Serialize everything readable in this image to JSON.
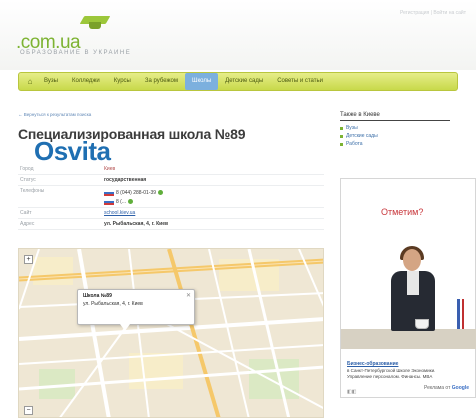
{
  "header": {
    "logo_main": "Osvita",
    "logo_domain": ".com.ua",
    "logo_tagline": "ОБРАЗОВАНИЕ В УКРАИНЕ",
    "top_links": "Регистрация  |  Войти на сайт"
  },
  "nav": {
    "home_icon": "home-icon",
    "items": [
      "Вузы",
      "Колледжи",
      "Курсы",
      "За рубежом",
      "Школы",
      "Детские сады",
      "Советы и статьи"
    ],
    "active_index": 4
  },
  "breadcrumb": "← Вернуться к результатам поиска",
  "page_title": "Специализированная школа №89",
  "details": {
    "city_label": "Город",
    "city_value": "Киев",
    "status_label": "Статус",
    "status_value": "государственная",
    "phones_label": "Телефоны",
    "phone1": "8 (044) 288-01-39",
    "phone2": "8 (...",
    "site_label": "Сайт",
    "site_value": "school.kiev.ua",
    "address_label": "Адрес",
    "address_value": "ул. Рыбальская, 4, г. Киев"
  },
  "map": {
    "balloon_title": "Школа №89",
    "balloon_address": "ул. Рыбальская, 4, г. Киев",
    "close_icon": "close-icon",
    "zoom_in": "+",
    "zoom_out": "−"
  },
  "sidebar": {
    "title": "Также в Киеве",
    "items": [
      "Вузы",
      "Детские сады",
      "Работа"
    ]
  },
  "ad": {
    "question": "Отметим?",
    "caption": "Бизнес-образование",
    "desc1": "в Санкт-Петербургской Школе Экономики.",
    "desc2": "Управление персоналом. Финансы. MBA",
    "by_label": "Реклама от",
    "google": "Google"
  },
  "colors": {
    "nav_bg": "#d9e36a",
    "nav_active": "#7cb0de",
    "logo_blue": "#1f6fb2",
    "logo_green": "#7db332",
    "ad_red": "#c8363b"
  }
}
